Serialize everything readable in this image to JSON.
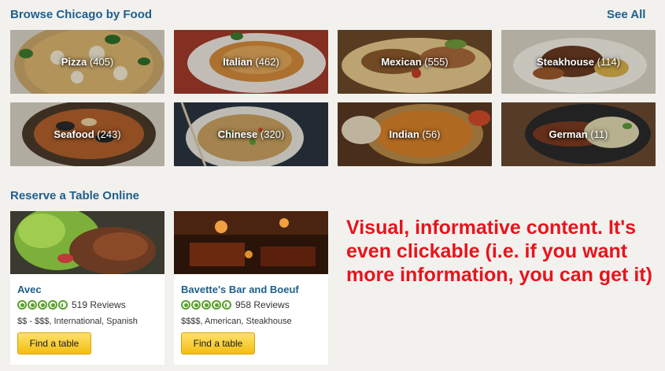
{
  "browse": {
    "title": "Browse Chicago by Food",
    "see_all": "See All",
    "categories": [
      {
        "name": "Pizza",
        "count": "(405)"
      },
      {
        "name": "Italian",
        "count": "(462)"
      },
      {
        "name": "Mexican",
        "count": "(555)"
      },
      {
        "name": "Steakhouse",
        "count": "(114)"
      },
      {
        "name": "Seafood",
        "count": "(243)"
      },
      {
        "name": "Chinese",
        "count": "(320)"
      },
      {
        "name": "Indian",
        "count": "(56)"
      },
      {
        "name": "German",
        "count": "(11)"
      }
    ]
  },
  "reserve": {
    "title": "Reserve a Table Online",
    "restaurants": [
      {
        "name": "Avec",
        "rating": 4.5,
        "reviews": "519 Reviews",
        "tags": "$$ - $$$, International, Spanish",
        "button": "Find a table"
      },
      {
        "name": "Bavette's Bar and Boeuf",
        "rating": 4.5,
        "reviews": "958 Reviews",
        "tags": "$$$$, American, Steakhouse",
        "button": "Find a table"
      }
    ]
  },
  "annotation": {
    "text": "Visual, informative content. It's even clickable (i.e. if you want more information, you can get it)"
  },
  "colors": {
    "link_blue": "#1f5f8b",
    "rating_green": "#5aa02c",
    "button_yellow": "#f4be12",
    "annotation_red": "#e8141c"
  }
}
